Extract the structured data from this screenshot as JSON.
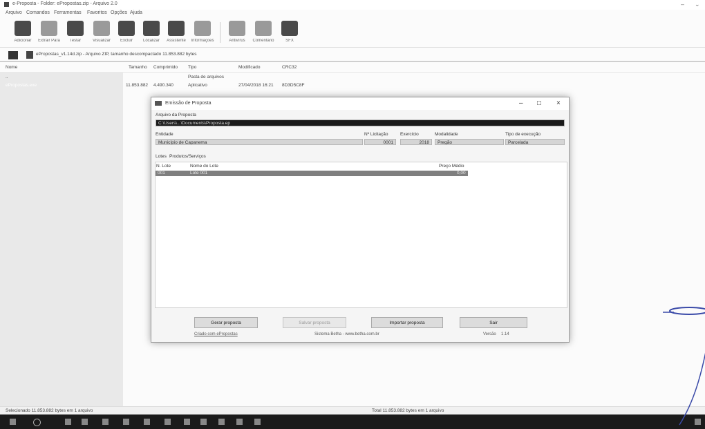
{
  "app": {
    "title": "e-Proposta - Folder: ePropostas.zip - Arquivo 2.0",
    "controls": [
      "–",
      "⌄"
    ]
  },
  "menu": [
    "Arquivo",
    "Comandos",
    "Ferramentas",
    "Favoritos",
    "Opções",
    "Ajuda"
  ],
  "toolbar": [
    {
      "label": "Adicionar",
      "icon": "add-archive-icon"
    },
    {
      "label": "Extrair Para",
      "icon": "extract-icon"
    },
    {
      "label": "Testar",
      "icon": "test-icon"
    },
    {
      "label": "Visualizar",
      "icon": "view-icon"
    },
    {
      "label": "Excluir",
      "icon": "delete-icon"
    },
    {
      "label": "Localizar",
      "icon": "find-icon"
    },
    {
      "label": "Assistente",
      "icon": "wizard-icon"
    },
    {
      "label": "Informações",
      "icon": "info-icon"
    },
    {
      "label": "Antivírus",
      "icon": "antivirus-icon"
    },
    {
      "label": "Comentário",
      "icon": "comment-icon"
    },
    {
      "label": "SFX",
      "icon": "sfx-icon"
    }
  ],
  "address": {
    "text": "ePropostas_v1.14d.zip - Arquivo ZIP, tamanho descompactado 11.853.882 bytes"
  },
  "list": {
    "columns": [
      "Nome",
      "Tamanho",
      "Comprimido",
      "Tipo",
      "Modificado",
      "CRC32"
    ],
    "rows": [
      {
        "name": "..",
        "size": "",
        "packed": "",
        "type": "Pasta de arquivos",
        "modified": "",
        "crc": ""
      },
      {
        "name": "ePropostas.exe",
        "size": "11.853.882",
        "packed": "4.490.340",
        "type": "Aplicativo",
        "modified": "27/04/2018 16:21",
        "crc": "8D3D5C8F"
      }
    ]
  },
  "status": {
    "left": "Selecionado 11.853.882 bytes em 1 arquivo",
    "right": "Total 11.853.882 bytes em 1 arquivo"
  },
  "dialog": {
    "title": "Emissão de Proposta",
    "controls": [
      "–",
      "□",
      "×"
    ],
    "file_label": "Arquivo da Proposta",
    "file_value": "C:\\Users\\...\\Documents\\Proposta.ep",
    "entity_label": "Entidade",
    "entity_value": "Município de Capanema",
    "licitacao_label": "Nº Licitação",
    "licitacao_value": "0001",
    "exercicio_label": "Exercício",
    "exercicio_value": "2018",
    "modalidade_label": "Modalidade",
    "modalidade_value": "Pregão",
    "tipo_label": "Tipo de execução",
    "tipo_value": "Parcelada",
    "tabs": [
      "Lotes",
      "Produtos/Serviços"
    ],
    "grid_cols": [
      "N. Lote",
      "Nome do Lote",
      "Preço Médio"
    ],
    "grid_rows": [
      {
        "n": "001",
        "name": "Lote 001",
        "price": "0,00"
      }
    ],
    "buttons": [
      "Gerar proposta",
      "Salvar proposta",
      "Importar proposta",
      "Sair"
    ],
    "footer_link": "Criado com ePropostas",
    "footer_center": "Sistema Betha - www.betha.com.br",
    "footer_version_label": "Versão",
    "footer_version": "1.14"
  }
}
